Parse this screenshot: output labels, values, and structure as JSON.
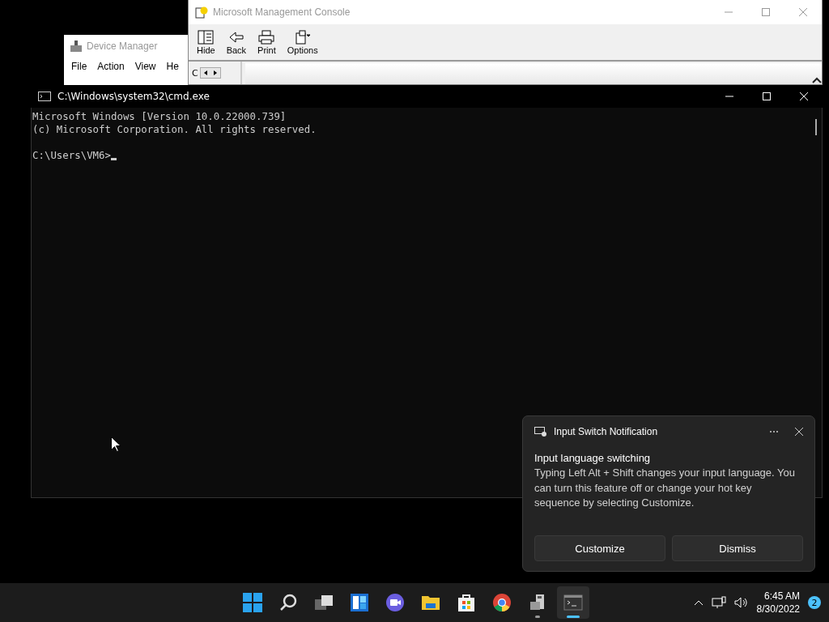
{
  "device_manager": {
    "title": "Device Manager",
    "menu": [
      "File",
      "Action",
      "View",
      "He"
    ]
  },
  "mmc": {
    "title": "Microsoft Management Console",
    "toolbar": [
      {
        "kind": "hide",
        "label": "Hide"
      },
      {
        "kind": "back",
        "label": "Back"
      },
      {
        "kind": "print",
        "label": "Print"
      },
      {
        "kind": "options",
        "label": "Options"
      }
    ],
    "pane_label": "C"
  },
  "console": {
    "title": "C:\\Windows\\system32\\cmd.exe",
    "lines": [
      "Microsoft Windows [Version 10.0.22000.739]",
      "(c) Microsoft Corporation. All rights reserved."
    ],
    "prompt": "C:\\Users\\VM6>"
  },
  "notification": {
    "app": "Input Switch Notification",
    "heading": "Input language switching",
    "body": "Typing Left Alt + Shift changes your input language. You can turn this feature off or change your hot key sequence by selecting Customize.",
    "buttons": [
      "Customize",
      "Dismiss"
    ]
  },
  "taskbar": {
    "apps": [
      {
        "kind": "start",
        "running": false,
        "selected": false
      },
      {
        "kind": "search",
        "running": false,
        "selected": false
      },
      {
        "kind": "taskview",
        "running": false,
        "selected": false
      },
      {
        "kind": "widgets",
        "running": false,
        "selected": false
      },
      {
        "kind": "chat",
        "running": false,
        "selected": false
      },
      {
        "kind": "explorer",
        "running": false,
        "selected": false
      },
      {
        "kind": "store",
        "running": false,
        "selected": false
      },
      {
        "kind": "chrome",
        "running": false,
        "selected": false
      },
      {
        "kind": "devmgr",
        "running": true,
        "selected": false
      },
      {
        "kind": "terminal",
        "running": true,
        "selected": true
      }
    ],
    "time": "6:45 AM",
    "date": "8/30/2022",
    "badge": "2"
  }
}
